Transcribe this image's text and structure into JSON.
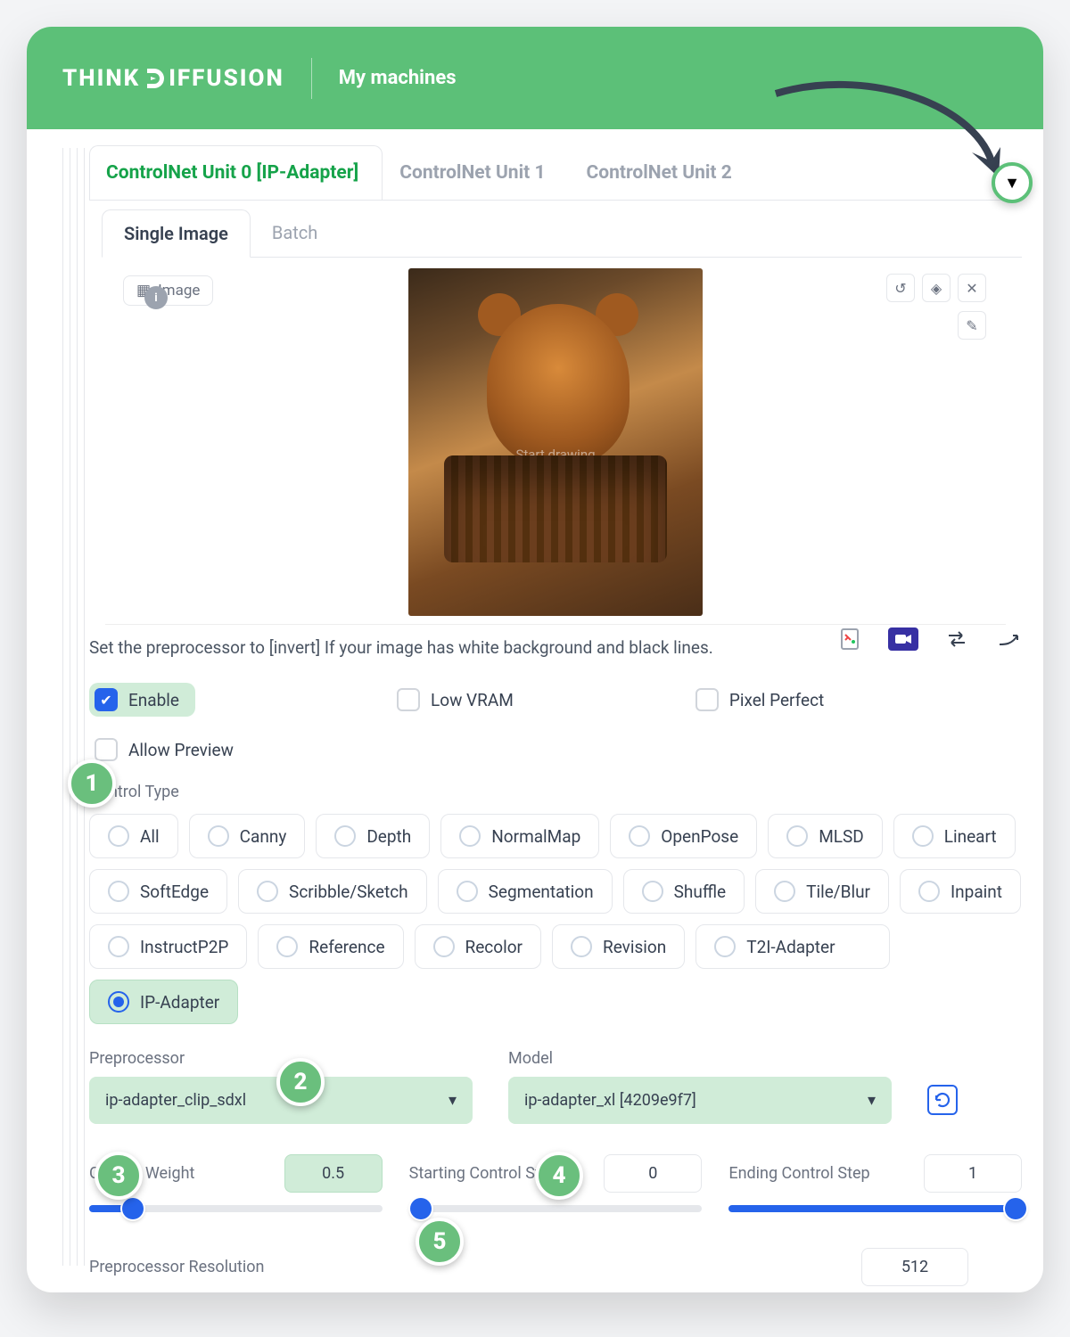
{
  "brand": {
    "pre": "THINK",
    "post": "IFFUSION"
  },
  "nav": {
    "machines": "My machines"
  },
  "tabs": {
    "u0": "ControlNet Unit 0 [IP-Adapter]",
    "u1": "ControlNet Unit 1",
    "u2": "ControlNet Unit 2"
  },
  "subtabs": {
    "single": "Single Image",
    "batch": "Batch"
  },
  "image": {
    "badge": "Image",
    "overlay": "Start drawing"
  },
  "hint": "Set the preprocessor to [invert] If your image has white background and black lines.",
  "checks": {
    "enable": "Enable",
    "lowvram": "Low VRAM",
    "pixel": "Pixel Perfect",
    "allow": "Allow Preview"
  },
  "controlType": {
    "label": "Control Type",
    "opts": [
      "All",
      "Canny",
      "Depth",
      "NormalMap",
      "OpenPose",
      "MLSD",
      "Lineart",
      "SoftEdge",
      "Scribble/Sketch",
      "Segmentation",
      "Shuffle",
      "Tile/Blur",
      "Inpaint",
      "InstructP2P",
      "Reference",
      "Recolor",
      "Revision",
      "T2I-Adapter",
      "IP-Adapter"
    ]
  },
  "preproc": {
    "label": "Preprocessor",
    "value": "ip-adapter_clip_sdxl"
  },
  "model": {
    "label": "Model",
    "value": "ip-adapter_xl [4209e9f7]"
  },
  "sliders": {
    "weight": {
      "label": "Control Weight",
      "value": "0.5"
    },
    "start": {
      "label": "Starting Control Step",
      "value": "0"
    },
    "end": {
      "label": "Ending Control Step",
      "value": "1"
    }
  },
  "resolution": {
    "label": "Preprocessor Resolution",
    "value": "512"
  },
  "arrows": {
    "down": "▼",
    "caret": "▾"
  },
  "callouts": {
    "b1": "1",
    "b2": "2",
    "b3": "3",
    "b4": "4",
    "b5": "5"
  }
}
